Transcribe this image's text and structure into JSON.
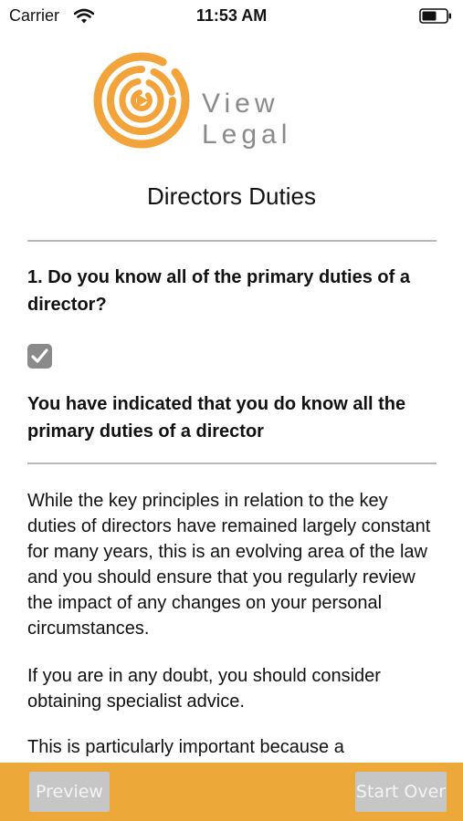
{
  "status": {
    "carrier": "Carrier",
    "time": "11:53 AM"
  },
  "logo": {
    "text": "View Legal",
    "accent_color": "#f2a33a"
  },
  "page": {
    "title": "Directors Duties"
  },
  "question": {
    "text": "1. Do you know all of the primary duties of a director?",
    "checked": true
  },
  "answer": {
    "text": "You have indicated that you do know all the primary duties of a director"
  },
  "content": {
    "paragraph1": "While the key principles in relation to the key duties of directors have remained largely constant for many years, this is an evolving area of the law and you should ensure that you regularly review the impact of any changes on your personal circumstances.",
    "paragraph2": "If you are in any doubt, you should consider obtaining specialist advice.",
    "paragraph3": "This is particularly important because a"
  },
  "bottom_bar": {
    "background": "#eda83a",
    "preview_label": "Preview",
    "start_over_label": "Start Over"
  },
  "icons": [
    "wifi-icon",
    "battery-icon",
    "checkmark-icon",
    "logo-spiral-icon"
  ]
}
